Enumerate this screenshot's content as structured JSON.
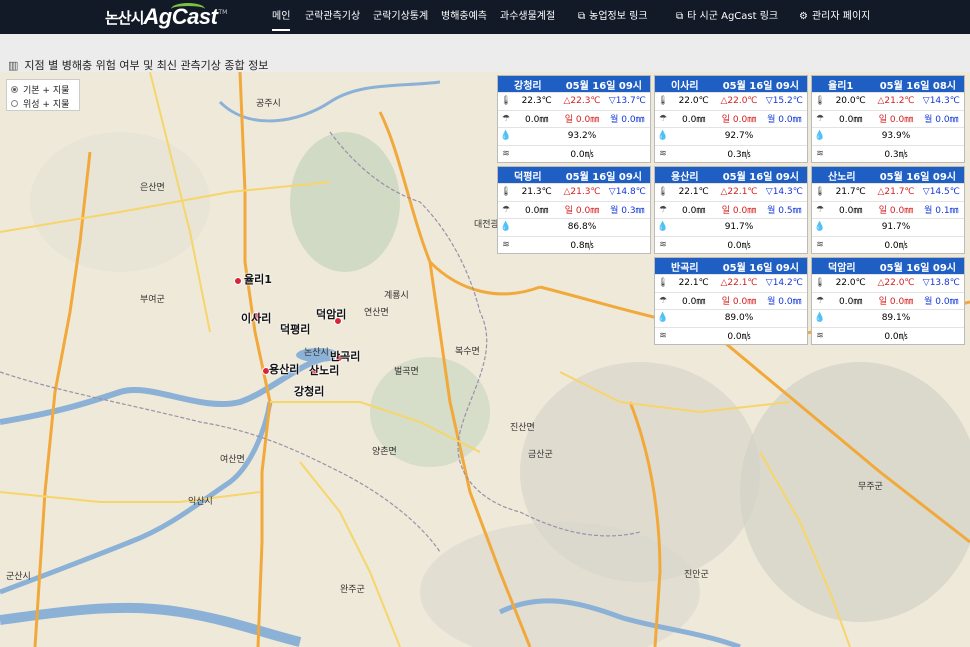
{
  "brand": {
    "name_ko": "논산시",
    "name_en": "AgCast",
    "tm": "TM"
  },
  "nav": {
    "items": [
      {
        "label": "메인"
      },
      {
        "label": "군락관측기상"
      },
      {
        "label": "군락기상통계"
      },
      {
        "label": "병해충예측"
      },
      {
        "label": "과수생물계절"
      },
      {
        "label": "농업정보 링크"
      },
      {
        "label": "타 시군 AgCast 링크"
      },
      {
        "label": "관리자 페이지"
      }
    ]
  },
  "page": {
    "title": "지점 별 병해충 위험 여부 및 최신 관측기상 종합 정보"
  },
  "layers": {
    "options": [
      "기본 + 지물",
      "위성 + 지물"
    ]
  },
  "map": {
    "labels": [
      "공주시",
      "은산면",
      "부여군",
      "익산시",
      "군산시",
      "논산시",
      "계룡시",
      "대전광",
      "금산군",
      "연산면",
      "여산면",
      "벌곡면",
      "양촌면",
      "진산면",
      "복수면",
      "무주군",
      "진안군",
      "완주군"
    ],
    "markers": [
      "율리1",
      "이사리",
      "덕평리",
      "덕암리",
      "용산리",
      "반곡리",
      "산노리",
      "강청리"
    ]
  },
  "stations": [
    {
      "name": "강청리",
      "time": "05월 16일 09시",
      "temp": "22.3℃",
      "max": "△22.3℃",
      "min": "▽13.7℃",
      "rain": "0.0㎜",
      "day_label": "일",
      "day_val": "0.0㎜",
      "month_label": "월",
      "month_val": "0.0㎜",
      "humidity": "93.2%",
      "wind": "0.0㎧"
    },
    {
      "name": "이사리",
      "time": "05월 16일 09시",
      "temp": "22.0℃",
      "max": "△22.0℃",
      "min": "▽15.2℃",
      "rain": "0.0㎜",
      "day_label": "일",
      "day_val": "0.0㎜",
      "month_label": "월",
      "month_val": "0.0㎜",
      "humidity": "92.7%",
      "wind": "0.3㎧"
    },
    {
      "name": "율리1",
      "time": "05월 16일 08시",
      "temp": "20.0℃",
      "max": "△21.2℃",
      "min": "▽14.3℃",
      "rain": "0.0㎜",
      "day_label": "일",
      "day_val": "0.0㎜",
      "month_label": "월",
      "month_val": "0.0㎜",
      "humidity": "93.9%",
      "wind": "0.3㎧"
    },
    {
      "name": "덕평리",
      "time": "05월 16일 09시",
      "temp": "21.3℃",
      "max": "△21.3℃",
      "min": "▽14.8℃",
      "rain": "0.0㎜",
      "day_label": "일",
      "day_val": "0.0㎜",
      "month_label": "월",
      "month_val": "0.3㎜",
      "humidity": "86.8%",
      "wind": "0.8㎧"
    },
    {
      "name": "용산리",
      "time": "05월 16일 09시",
      "temp": "22.1℃",
      "max": "△22.1℃",
      "min": "▽14.3℃",
      "rain": "0.0㎜",
      "day_label": "일",
      "day_val": "0.0㎜",
      "month_label": "월",
      "month_val": "0.5㎜",
      "humidity": "91.7%",
      "wind": "0.0㎧"
    },
    {
      "name": "산노리",
      "time": "05월 16일 09시",
      "temp": "21.7℃",
      "max": "△21.7℃",
      "min": "▽14.5℃",
      "rain": "0.0㎜",
      "day_label": "일",
      "day_val": "0.0㎜",
      "month_label": "월",
      "month_val": "0.1㎜",
      "humidity": "91.7%",
      "wind": "0.0㎧"
    },
    {
      "name": "반곡리",
      "time": "05월 16일 09시",
      "temp": "22.1℃",
      "max": "△22.1℃",
      "min": "▽14.2℃",
      "rain": "0.0㎜",
      "day_label": "일",
      "day_val": "0.0㎜",
      "month_label": "월",
      "month_val": "0.0㎜",
      "humidity": "89.0%",
      "wind": "0.0㎧"
    },
    {
      "name": "덕암리",
      "time": "05월 16일 09시",
      "temp": "22.0℃",
      "max": "△22.0℃",
      "min": "▽13.8℃",
      "rain": "0.0㎜",
      "day_label": "일",
      "day_val": "0.0㎜",
      "month_label": "월",
      "month_val": "0.0㎜",
      "humidity": "89.1%",
      "wind": "0.0㎧"
    }
  ],
  "colors": {
    "navbar": "#121a28",
    "card_header": "#1f5fc4",
    "max_temp": "#d32121",
    "min_temp": "#1438d6",
    "marker": "#d6243a",
    "brand_accent": "#7cc242"
  }
}
